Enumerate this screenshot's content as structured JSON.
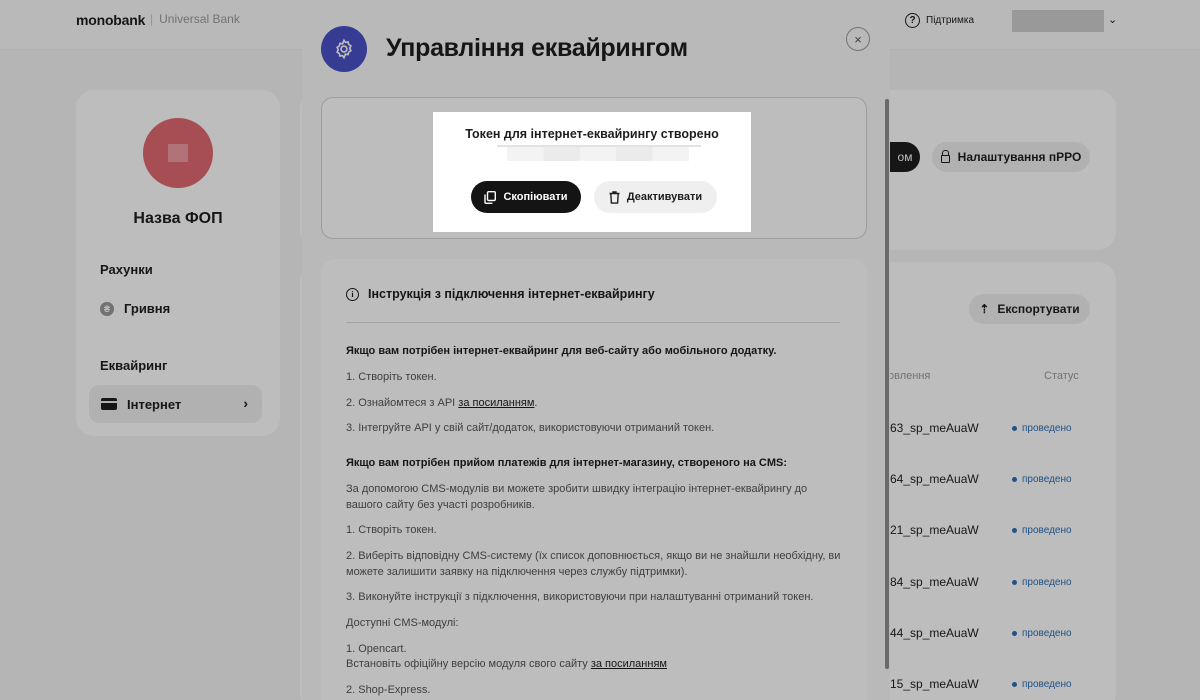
{
  "topbar": {
    "logo": "monobank",
    "logo_sub": "Universal Bank",
    "support": "Підтримка"
  },
  "sidebar": {
    "fop_name": "Назва ФОП",
    "accounts_title": "Рахунки",
    "account_item": "Гривня",
    "acquiring_title": "Еквайринг",
    "acquiring_item": "Інтернет"
  },
  "main": {
    "prro_button": "Налаштування пРРО",
    "dark_button_partial": "ом",
    "export_button": "Експортувати",
    "col_order": "овлення",
    "col_status": "Статус",
    "rows": [
      {
        "id": "63_sp_meAuaW",
        "status": "проведено"
      },
      {
        "id": "64_sp_meAuaW",
        "status": "проведено"
      },
      {
        "id": "21_sp_meAuaW",
        "status": "проведено"
      },
      {
        "id": "84_sp_meAuaW",
        "status": "проведено"
      },
      {
        "id": "44_sp_meAuaW",
        "status": "проведено"
      },
      {
        "id": "15_sp_meAuaW",
        "status": "проведено"
      }
    ]
  },
  "modal": {
    "title": "Управління еквайрингом",
    "close_label": "×",
    "popup": {
      "title": "Токен для інтернет-еквайрингу створено",
      "copy_label": "Скопіювати",
      "deactivate_label": "Деактивувати"
    },
    "instructions": {
      "heading": "Інструкція з підключення інтернет-еквайрингу",
      "site_title": "Якщо вам потрібен інтернет-еквайринг для веб-сайту або мобільного додатку.",
      "site_step1": "1. Створіть токен.",
      "site_step2_prefix": "2. Ознайомтеся з API ",
      "site_step2_link": "за посиланням",
      "site_step2_suffix": ".",
      "site_step3": "3. Інтегруйте API у свій сайт/додаток, використовуючи отриманий токен.",
      "cms_title": "Якщо вам потрібен прийом платежів для інтернет-магазину, створеного на CMS:",
      "cms_intro": "За допомогою CMS-модулів ви можете зробити швидку інтеграцію інтернет-еквайрингу до вашого сайту без участі розробників.",
      "cms_step1": "1. Створіть токен.",
      "cms_step2": "2. Виберіть відповідну CMS-систему (їх список доповнюється, якщо ви не знайшли необхідну, ви можете залишити заявку на підключення через службу підтримки).",
      "cms_step3": "3. Виконуйте інструкції з підключення, використовуючи при налаштуванні отриманий токен.",
      "modules_title": "Доступні CMS-модулі:",
      "module1": "1. Opencart.",
      "module1_desc_prefix": "Встановіть офіційну версію модуля свого сайту ",
      "module1_link": "за посиланням",
      "module2": "2. Shop-Express."
    }
  }
}
